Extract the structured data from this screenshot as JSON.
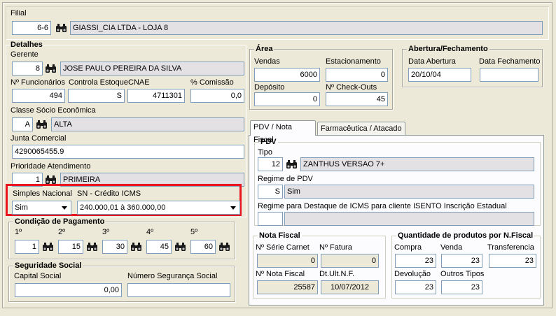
{
  "filial": {
    "title": "Filial",
    "code": "6-6",
    "name": "GIASSI_CIA LTDA - LOJA 8"
  },
  "detalhes": {
    "title": "Detalhes",
    "gerente_label": "Gerente",
    "gerente_code": "8",
    "gerente_name": "JOSE PAULO PEREIRA DA SILVA",
    "funcionarios_label": "Nº Funcionários",
    "funcionarios_value": "494",
    "controla_label": "Controla Estoque",
    "controla_value": "S",
    "cnae_label": "CNAE",
    "cnae_value": "4711301",
    "comissao_label": "% Comissão",
    "comissao_value": "0,0",
    "classe_label": "Classe Sócio Econômica",
    "classe_code": "A",
    "classe_name": "ALTA",
    "junta_label": "Junta Comercial",
    "junta_value": "4290065455.9",
    "prioridade_label": "Prioridade Atendimento",
    "prioridade_code": "1",
    "prioridade_name": "PRIMEIRA",
    "simples_label": "Simples Nacional",
    "simples_value": "Sim",
    "sn_label": "SN - Crédito ICMS",
    "sn_value": "240.000,01 à 360.000,00"
  },
  "pagamento": {
    "title": "Condição de Pagamento",
    "items": [
      {
        "label": "1º",
        "value": "1"
      },
      {
        "label": "2º",
        "value": "15"
      },
      {
        "label": "3º",
        "value": "30"
      },
      {
        "label": "4º",
        "value": "45"
      },
      {
        "label": "5º",
        "value": "60"
      }
    ]
  },
  "seguridade": {
    "title": "Seguridade Social",
    "capital_label": "Capital Social",
    "capital_value": "0,00",
    "numero_label": "Número Segurança Social",
    "numero_value": ""
  },
  "area": {
    "title": "Área",
    "vendas_label": "Vendas",
    "vendas_value": "6000",
    "estacionamento_label": "Estacionamento",
    "estacionamento_value": "0",
    "deposito_label": "Depósito",
    "deposito_value": "0",
    "checkouts_label": "Nº Check-Outs",
    "checkouts_value": "45"
  },
  "abertura": {
    "title": "Abertura/Fechamento",
    "abertura_label": "Data Abertura",
    "abertura_value": "20/10/04",
    "fechamento_label": "Data Fechamento",
    "fechamento_value": ""
  },
  "tabs": {
    "tab1": "PDV / Nota Fiscal",
    "tab2": "Farmacêutica / Atacado"
  },
  "pdv": {
    "title": "PDV",
    "tipo_label": "Tipo",
    "tipo_code": "12",
    "tipo_name": "ZANTHUS VERSAO 7+",
    "regime_label": "Regime de PDV",
    "regime_code": "S",
    "regime_name": "Sim",
    "regime_icms_label": "Regime para Destaque de ICMS para cliente ISENTO Inscrição Estadual",
    "regime_icms_code": "",
    "regime_icms_name": ""
  },
  "nota": {
    "title": "Nota Fiscal",
    "serie_label": "Nº Série Carnet",
    "serie_value": "0",
    "fatura_label": "Nº Fatura",
    "fatura_value": "0",
    "nota_label": "Nº Nota Fiscal",
    "nota_value": "25587",
    "dt_label": "Dt.Ult.N.F.",
    "dt_value": "10/07/2012"
  },
  "quantidade": {
    "title": "Quantidade de produtos por N.Fiscal",
    "compra_label": "Compra",
    "compra_value": "23",
    "venda_label": "Venda",
    "venda_value": "23",
    "transferencia_label": "Transferencia",
    "transferencia_value": "23",
    "devolucao_label": "Devolução",
    "devolucao_value": "23",
    "outros_label": "Outros Tipos",
    "outros_value": "23"
  },
  "colors": {
    "highlight": "#e8141e",
    "window_bg": "#ece9d8",
    "field_border": "#7f9db9"
  },
  "icons": [
    "binoculars-icon",
    "chevron-down-icon"
  ]
}
